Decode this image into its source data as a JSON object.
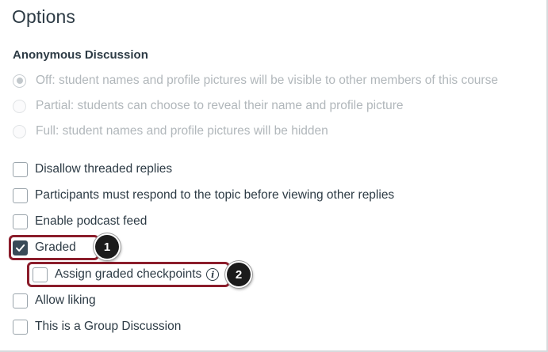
{
  "panel": {
    "title": "Options"
  },
  "anonymous": {
    "label": "Anonymous Discussion",
    "options": [
      {
        "label": "Off: student names and profile pictures will be visible to other members of this course",
        "selected": true
      },
      {
        "label": "Partial: students can choose to reveal their name and profile picture",
        "selected": false
      },
      {
        "label": "Full: student names and profile pictures will be hidden",
        "selected": false
      }
    ]
  },
  "checkboxes": {
    "disallow_threaded": {
      "label": "Disallow threaded replies",
      "checked": false
    },
    "must_respond": {
      "label": "Participants must respond to the topic before viewing other replies",
      "checked": false
    },
    "podcast": {
      "label": "Enable podcast feed",
      "checked": false
    },
    "graded": {
      "label": "Graded",
      "checked": true
    },
    "checkpoints": {
      "label": "Assign graded checkpoints",
      "checked": false
    },
    "allow_liking": {
      "label": "Allow liking",
      "checked": false
    },
    "group_discussion": {
      "label": "This is a Group Discussion",
      "checked": false
    }
  },
  "callouts": {
    "first": "1",
    "second": "2"
  },
  "icons": {
    "info": "i",
    "checkmark": "check-icon"
  },
  "colors": {
    "highlight": "#8b1d2b",
    "checked_fill": "#394b58",
    "text": "#2d3b45",
    "disabled_text": "#b1b7bb"
  }
}
